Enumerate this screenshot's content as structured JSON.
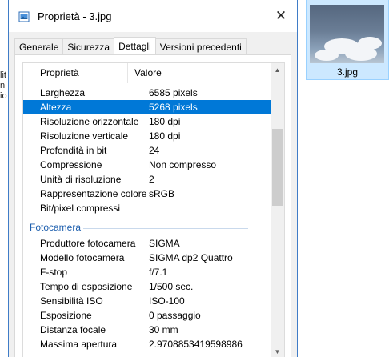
{
  "window": {
    "title": "Proprietà - 3.jpg",
    "close_symbol": "✕"
  },
  "tabs": [
    {
      "label": "Generale"
    },
    {
      "label": "Sicurezza"
    },
    {
      "label": "Dettagli"
    },
    {
      "label": "Versioni precedenti"
    }
  ],
  "active_tab": "Dettagli",
  "list": {
    "header": {
      "property": "Proprietà",
      "value": "Valore"
    },
    "image_rows": [
      {
        "property": "Larghezza",
        "value": "6585 pixels"
      },
      {
        "property": "Altezza",
        "value": "5268 pixels"
      },
      {
        "property": "Risoluzione orizzontale",
        "value": "180 dpi"
      },
      {
        "property": "Risoluzione verticale",
        "value": "180 dpi"
      },
      {
        "property": "Profondità in bit",
        "value": "24"
      },
      {
        "property": "Compressione",
        "value": "Non compresso"
      },
      {
        "property": "Unità di risoluzione",
        "value": "2"
      },
      {
        "property": "Rappresentazione colore",
        "value": "sRGB"
      },
      {
        "property": "Bit/pixel compressi",
        "value": ""
      }
    ],
    "group_camera": "Fotocamera",
    "camera_rows": [
      {
        "property": "Produttore fotocamera",
        "value": "SIGMA"
      },
      {
        "property": "Modello fotocamera",
        "value": "SIGMA dp2 Quattro"
      },
      {
        "property": "F-stop",
        "value": "f/7.1"
      },
      {
        "property": "Tempo di esposizione",
        "value": "1/500 sec."
      },
      {
        "property": "Sensibilità ISO",
        "value": "ISO-100"
      },
      {
        "property": "Esposizione",
        "value": "0 passaggio"
      },
      {
        "property": "Distanza focale",
        "value": "30 mm"
      },
      {
        "property": "Massima apertura",
        "value": "2.9708853419598986"
      }
    ],
    "selected_property": "Altezza"
  },
  "background": {
    "file_label": "3.jpg",
    "left_fragment": "lit\nn\nio"
  },
  "colors": {
    "selection": "#0078d7",
    "group_title": "#1e5fae",
    "window_border": "#3f7cc7",
    "thumb_selection": "#cce8ff"
  }
}
